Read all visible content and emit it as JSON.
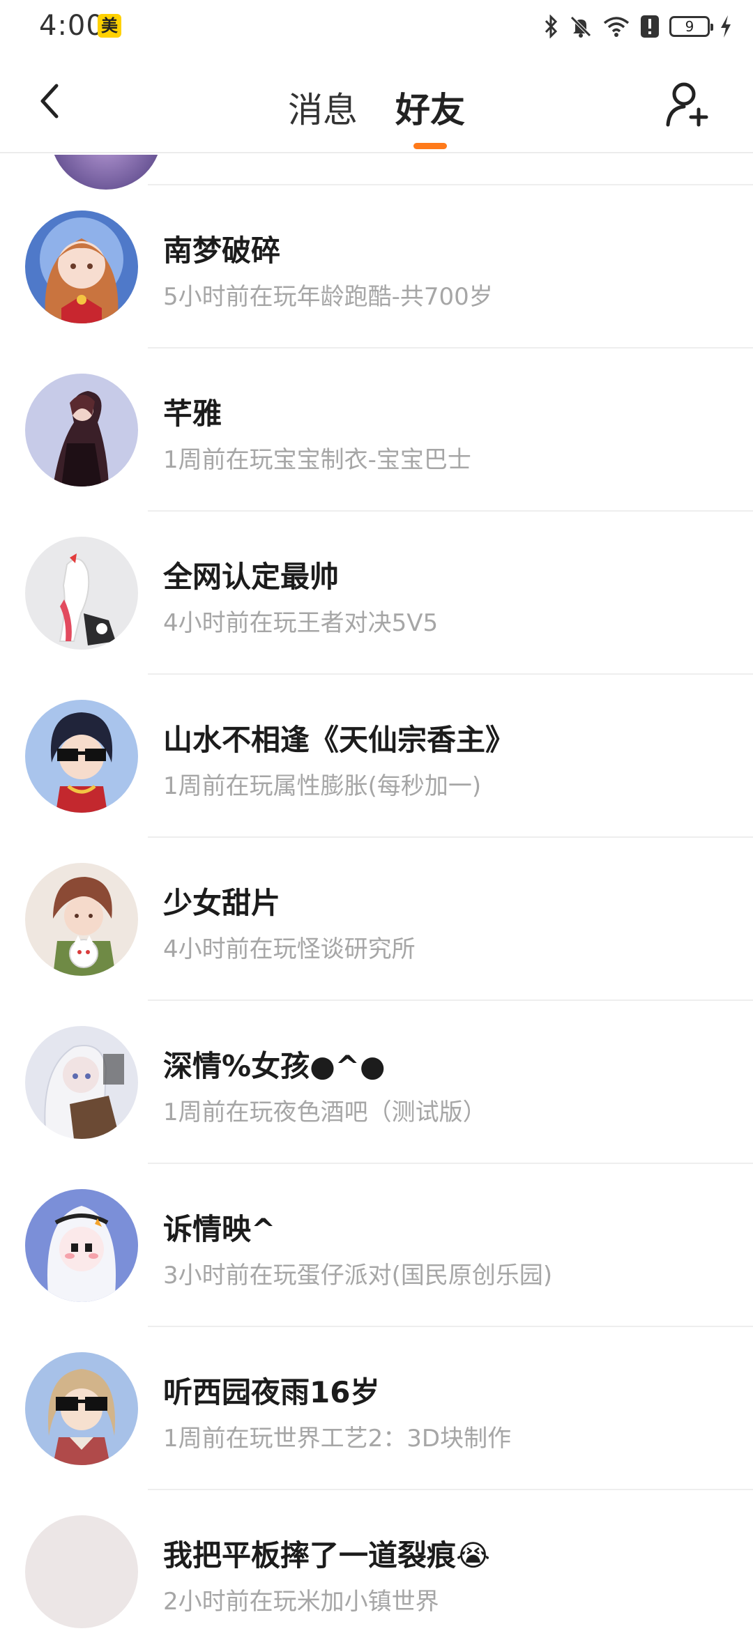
{
  "status_bar": {
    "time": "4:00",
    "app_badge": "美",
    "battery_level": "9",
    "icons": [
      "bluetooth-icon",
      "mute-icon",
      "wifi-icon",
      "alert-icon",
      "battery-icon",
      "charging-icon"
    ]
  },
  "nav": {
    "tabs": [
      {
        "label": "消息",
        "active": false
      },
      {
        "label": "好友",
        "active": true
      }
    ],
    "accent_color": "#ff7a1a"
  },
  "friends": [
    {
      "name": "南梦破碎",
      "activity": "5小时前在玩年龄跑酷-共700岁"
    },
    {
      "name": "芊雅",
      "activity": "1周前在玩宝宝制衣-宝宝巴士"
    },
    {
      "name": "全网认定最帅",
      "activity": "4小时前在玩王者对决5V5"
    },
    {
      "name": "山水不相逢《天仙宗香主》",
      "activity": "1周前在玩属性膨胀(每秒加一)"
    },
    {
      "name": "少女甜片",
      "activity": "4小时前在玩怪谈研究所"
    },
    {
      "name": "深情%女孩●^●",
      "activity": "1周前在玩夜色酒吧（测试版）"
    },
    {
      "name": "诉情映^",
      "activity": "3小时前在玩蛋仔派对(国民原创乐园)"
    },
    {
      "name": "听西园夜雨16岁",
      "activity": "1周前在玩世界工艺2：3D块制作"
    },
    {
      "name": "我把平板摔了一道裂痕😭",
      "activity": "2小时前在玩米加小镇世界"
    }
  ]
}
